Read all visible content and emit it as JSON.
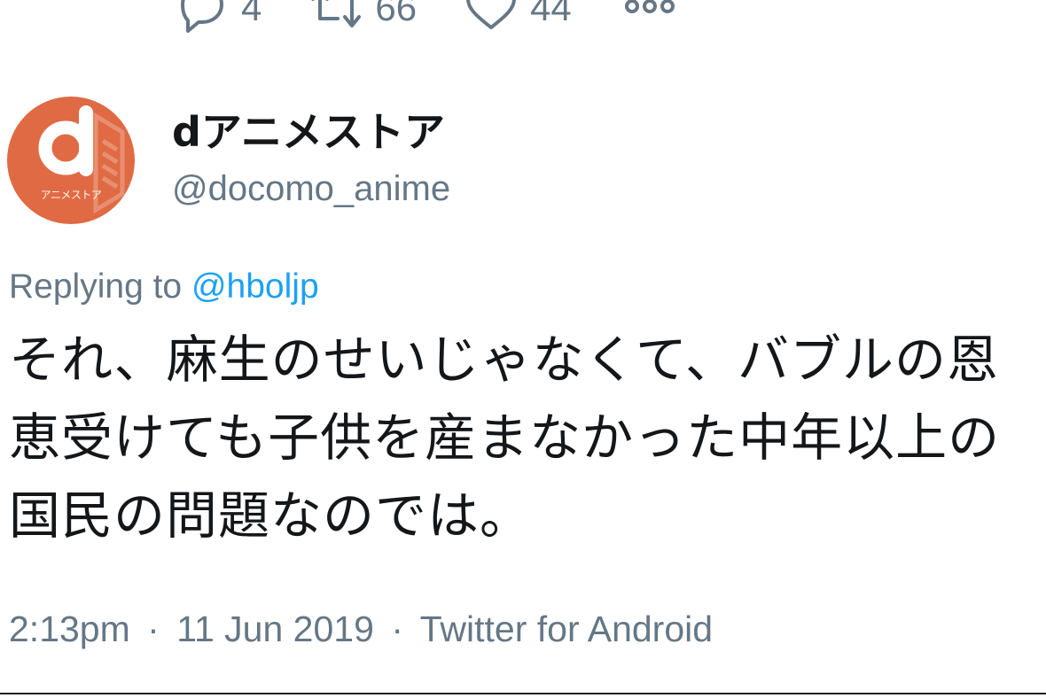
{
  "actions": {
    "reply_count": "4",
    "retweet_count": "66",
    "like_count": "44"
  },
  "author": {
    "display_name": "dアニメストア",
    "handle": "@docomo_anime",
    "avatar_brand": "アニメストア",
    "avatar_color": "#e06a43"
  },
  "reply": {
    "prefix": "Replying to ",
    "mention": "@hboljp"
  },
  "tweet": {
    "text": "それ、麻生のせいじゃなくて、バブルの恩恵受けても子供を産まなかった中年以上の国民の問題なのでは。"
  },
  "meta": {
    "time": "2:13pm",
    "date": "11 Jun 2019",
    "source": "Twitter for Android",
    "separator": "·"
  },
  "colors": {
    "text": "#14171a",
    "secondary": "#657786",
    "link": "#1da1f2"
  }
}
